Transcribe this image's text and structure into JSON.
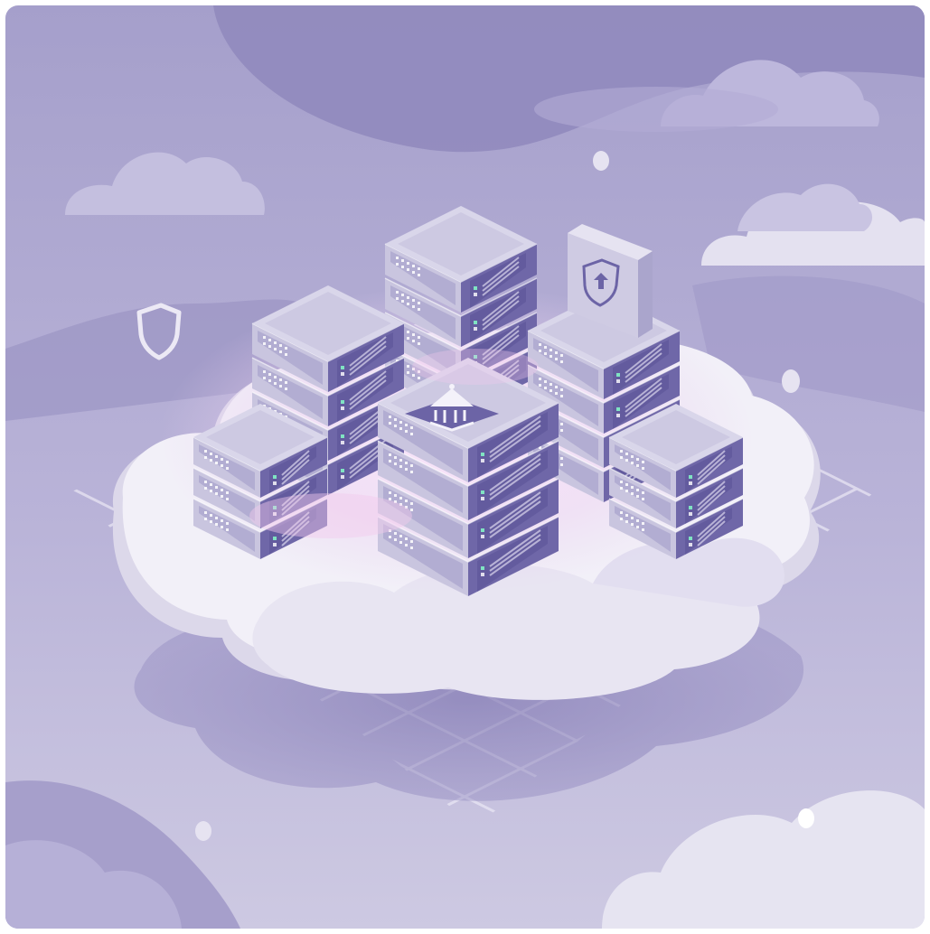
{
  "scene": {
    "subject": "isometric-server-racks-on-cloud",
    "colors": {
      "sky": "#a7a0cc",
      "sky_dark": "#8b84b8",
      "cloud": "#f2f0f7",
      "cloud_shade": "#dedaeb",
      "server_top": "#d9d6ea",
      "server_left": "#c9c5df",
      "server_right": "#6f67a8",
      "accent_glow": "#f3d9f5",
      "led": "#7fe3c2"
    },
    "icons": [
      "shield-icon",
      "bank-icon",
      "shield-lock-icon"
    ],
    "racks": [
      {
        "id": "back-center",
        "units": 4
      },
      {
        "id": "left-middle",
        "units": 4
      },
      {
        "id": "right-back",
        "units": 4
      },
      {
        "id": "left-front",
        "units": 3
      },
      {
        "id": "center-front",
        "units": 4
      },
      {
        "id": "right-front",
        "units": 3
      }
    ]
  }
}
